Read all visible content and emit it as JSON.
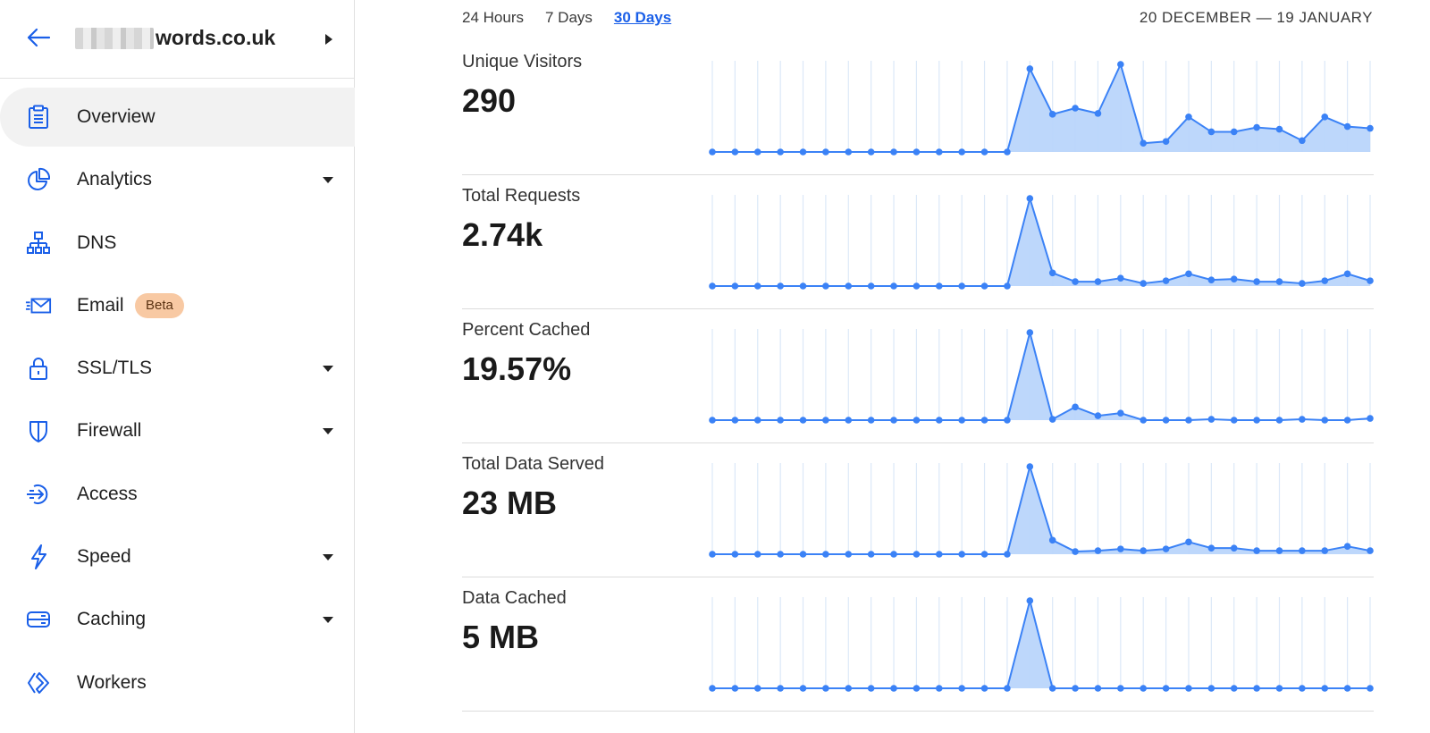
{
  "site": {
    "name_suffix": "words.co.uk"
  },
  "sidebar": {
    "items": [
      {
        "label": "Overview",
        "icon": "clipboard-icon",
        "active": true,
        "caret": false
      },
      {
        "label": "Analytics",
        "icon": "pie-chart-icon",
        "active": false,
        "caret": true
      },
      {
        "label": "DNS",
        "icon": "network-icon",
        "active": false,
        "caret": false
      },
      {
        "label": "Email",
        "icon": "envelope-icon",
        "active": false,
        "caret": false,
        "badge": "Beta"
      },
      {
        "label": "SSL/TLS",
        "icon": "lock-icon",
        "active": false,
        "caret": true
      },
      {
        "label": "Firewall",
        "icon": "shield-icon",
        "active": false,
        "caret": true
      },
      {
        "label": "Access",
        "icon": "access-icon",
        "active": false,
        "caret": false
      },
      {
        "label": "Speed",
        "icon": "lightning-icon",
        "active": false,
        "caret": true
      },
      {
        "label": "Caching",
        "icon": "server-icon",
        "active": false,
        "caret": true
      },
      {
        "label": "Workers",
        "icon": "workers-icon",
        "active": false,
        "caret": false
      }
    ]
  },
  "time_range": {
    "tabs": [
      "24 Hours",
      "7 Days",
      "30 Days"
    ],
    "active": "30 Days",
    "date_range": "20 DECEMBER — 19 JANUARY"
  },
  "colors": {
    "accent": "#1a5fe8",
    "line": "#3b82f6",
    "fill": "#b9d5fb",
    "grid": "#dbe8f8"
  },
  "metrics": [
    {
      "label": "Unique Visitors",
      "value": "290"
    },
    {
      "label": "Total Requests",
      "value": "2.74k"
    },
    {
      "label": "Percent Cached",
      "value": "19.57%"
    },
    {
      "label": "Total Data Served",
      "value": "23 MB"
    },
    {
      "label": "Data Cached",
      "value": "5 MB"
    }
  ],
  "chart_data": [
    {
      "type": "area",
      "series": [
        {
          "values": [
            0,
            0,
            0,
            0,
            0,
            0,
            0,
            0,
            0,
            0,
            0,
            0,
            0,
            0,
            95,
            43,
            50,
            44,
            100,
            10,
            12,
            40,
            23,
            23,
            28,
            26,
            13,
            40,
            29,
            27
          ]
        }
      ]
    },
    {
      "type": "area",
      "series": [
        {
          "values": [
            0,
            0,
            0,
            0,
            0,
            0,
            0,
            0,
            0,
            0,
            0,
            0,
            0,
            0,
            100,
            15,
            5,
            5,
            9,
            3,
            6,
            14,
            7,
            8,
            5,
            5,
            3,
            6,
            14,
            6
          ]
        }
      ]
    },
    {
      "type": "area",
      "series": [
        {
          "values": [
            0,
            0,
            0,
            0,
            0,
            0,
            0,
            0,
            0,
            0,
            0,
            0,
            0,
            0,
            100,
            1,
            15,
            5,
            8,
            0,
            0,
            0,
            1,
            0,
            0,
            0,
            1,
            0,
            0,
            2
          ]
        }
      ]
    },
    {
      "type": "area",
      "series": [
        {
          "values": [
            0,
            0,
            0,
            0,
            0,
            0,
            0,
            0,
            0,
            0,
            0,
            0,
            0,
            0,
            100,
            16,
            3,
            4,
            6,
            4,
            6,
            14,
            7,
            7,
            4,
            4,
            4,
            4,
            9,
            4
          ]
        }
      ]
    },
    {
      "type": "area",
      "series": [
        {
          "values": [
            0,
            0,
            0,
            0,
            0,
            0,
            0,
            0,
            0,
            0,
            0,
            0,
            0,
            0,
            100,
            0,
            0,
            0,
            0,
            0,
            0,
            0,
            0,
            0,
            0,
            0,
            0,
            0,
            0,
            0
          ]
        }
      ]
    }
  ]
}
